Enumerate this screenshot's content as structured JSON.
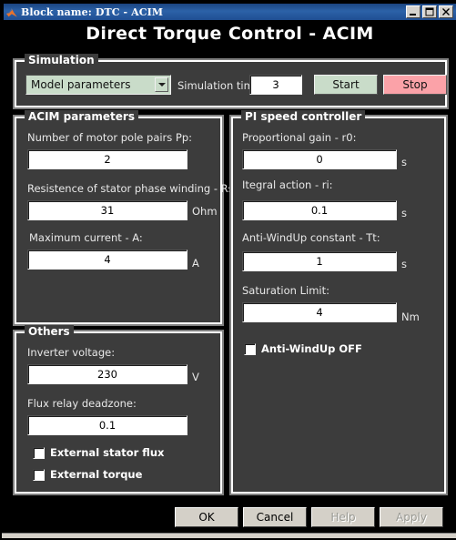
{
  "window": {
    "title": "Block name: DTC - ACIM",
    "icon": "matlab-icon",
    "controls": {
      "minimize": "_",
      "maximize": "□",
      "close": "✕"
    }
  },
  "header": {
    "title": "Direct Torque Control - ACIM"
  },
  "simulation": {
    "legend": "Simulation",
    "mode_selected": "Model parameters",
    "sim_time_label": "Simulation time:",
    "sim_time_value": "3",
    "start_label": "Start",
    "stop_label": "Stop",
    "start_color": "#c9dcc9",
    "stop_color": "#fba2a8"
  },
  "acim": {
    "legend": "ACIM parameters",
    "fields": [
      {
        "label": "Number of motor pole pairs Pp:",
        "value": "2",
        "unit": ""
      },
      {
        "label": "Resistence of stator phase winding - Rs:",
        "value": "31",
        "unit": "Ohm"
      },
      {
        "label": "Maximum current - A:",
        "value": "4",
        "unit": "A"
      }
    ]
  },
  "pi": {
    "legend": "PI speed controller",
    "fields": [
      {
        "label": "Proportional gain - r0:",
        "value": "0",
        "unit": "s"
      },
      {
        "label": "Itegral action - ri:",
        "value": "0.1",
        "unit": "s"
      },
      {
        "label": "Anti-WindUp constant - Tt:",
        "value": "1",
        "unit": "s"
      },
      {
        "label": "Saturation Limit:",
        "value": "4",
        "unit": "Nm"
      }
    ],
    "checkbox": {
      "label": "Anti-WindUp OFF",
      "checked": false
    }
  },
  "others": {
    "legend": "Others",
    "fields": [
      {
        "label": "Inverter voltage:",
        "value": "230",
        "unit": "V"
      },
      {
        "label": "Flux relay deadzone:",
        "value": "0.1",
        "unit": ""
      }
    ],
    "checkboxes": [
      {
        "label": "External stator flux",
        "checked": false
      },
      {
        "label": "External torque",
        "checked": false
      }
    ]
  },
  "footer": {
    "buttons": [
      {
        "label": "OK",
        "enabled": true
      },
      {
        "label": "Cancel",
        "enabled": true
      },
      {
        "label": "Help",
        "enabled": false
      },
      {
        "label": "Apply",
        "enabled": false
      }
    ]
  }
}
